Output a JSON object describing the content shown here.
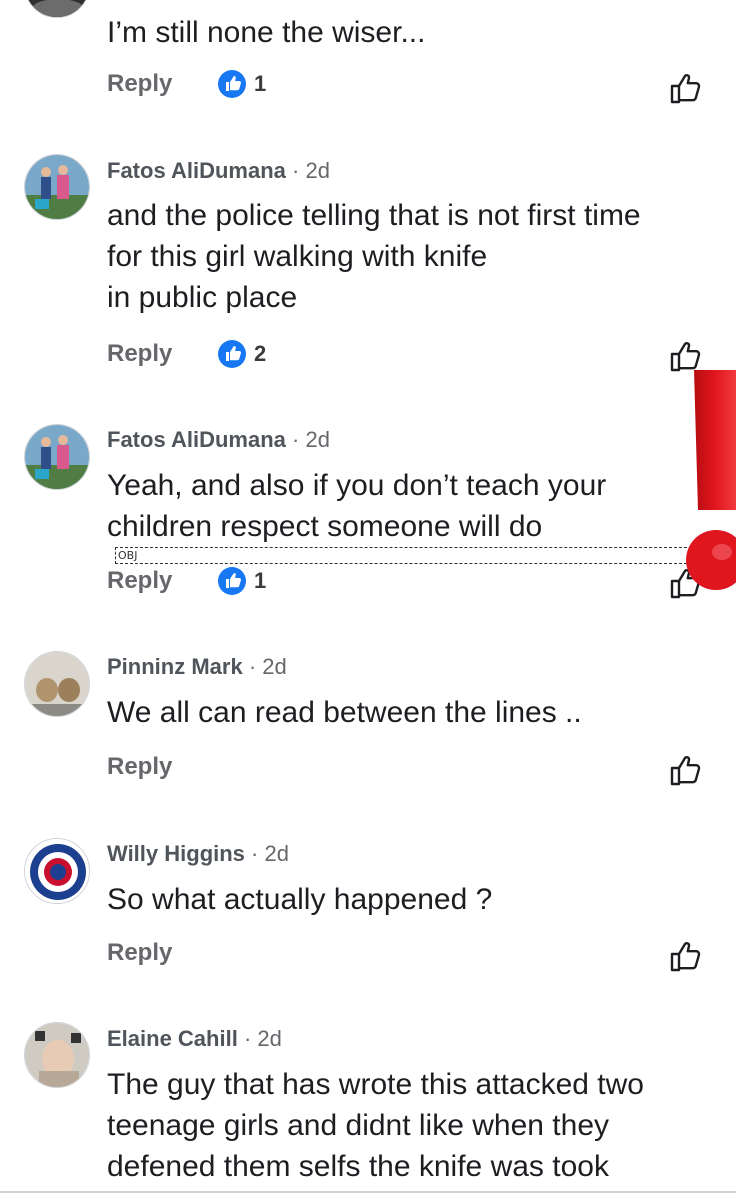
{
  "comments": [
    {
      "text_lines": [
        "I’m still none the wiser..."
      ],
      "reply_label": "Reply",
      "like_count": "1"
    },
    {
      "author": "Fatos AliDumana",
      "time": "· 2d",
      "text_lines": [
        "and the police telling that is not first time",
        "for this girl walking with knife",
        "in public place"
      ],
      "reply_label": "Reply",
      "like_count": "2"
    },
    {
      "author": "Fatos AliDumana",
      "time": "· 2d",
      "text_lines": [
        "Yeah, and also if you don’t teach your",
        "children respect someone will do"
      ],
      "obj_glyph": "OBJ",
      "reply_label": "Reply",
      "like_count": "1"
    },
    {
      "author": "Pinninz Mark",
      "time": "· 2d",
      "text_lines": [
        "We all can read between the lines .."
      ],
      "reply_label": "Reply"
    },
    {
      "author": "Willy Higgins",
      "time": "· 2d",
      "text_lines": [
        "So what actually happened ?"
      ],
      "reply_label": "Reply"
    },
    {
      "author": "Elaine Cahill",
      "time": "· 2d",
      "text_lines": [
        "The guy that has wrote this attacked two",
        "teenage girls and didnt like when they",
        "defened them selfs the knife was took"
      ]
    }
  ],
  "colors": {
    "like_blue": "#1877f2",
    "exclamation_red": "#e0161e",
    "text_dark": "#1c1e21",
    "text_muted": "#65676b"
  },
  "icons": {
    "like_badge": "thumbs-up-badge-icon",
    "like_button": "thumbs-up-outline-icon",
    "exclamation": "red-exclamation-mark"
  }
}
